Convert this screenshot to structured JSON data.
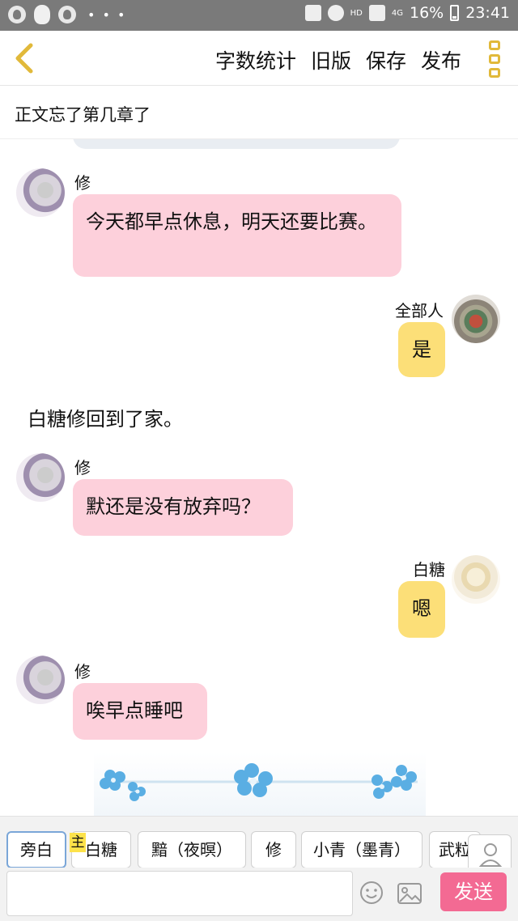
{
  "status_bar": {
    "more": "• • •",
    "hd": "HD",
    "signal": "4G",
    "battery": "16%",
    "time": "23:41"
  },
  "toolbar": {
    "back_icon": "chevron-left-icon",
    "actions": [
      "字数统计",
      "旧版",
      "保存",
      "发布"
    ],
    "menu_icon": "vertical-dots-icon",
    "accent_color": "#e1b93a"
  },
  "chapter": {
    "title": "正文忘了第几章了"
  },
  "messages": [
    {
      "side": "left",
      "sender": "修",
      "text": "今天都早点休息，明天还要比赛。",
      "bubble_color": "#fdd0db"
    },
    {
      "side": "right",
      "sender": "全部人",
      "text": "是",
      "bubble_color": "#fcdf78"
    },
    {
      "side": "narration",
      "text": "白糖修回到了家。"
    },
    {
      "side": "left",
      "sender": "修",
      "text": "默还是没有放弃吗？",
      "bubble_color": "#fdd0db"
    },
    {
      "side": "right",
      "sender": "白糖",
      "text": "嗯",
      "bubble_color": "#fcdf78"
    },
    {
      "side": "left",
      "sender": "修",
      "text": "唉早点睡吧",
      "bubble_color": "#fdd0db"
    }
  ],
  "character_bar": {
    "chips": [
      "旁白",
      "白糖",
      "黯（夜暝）",
      "修",
      "小青（墨青）",
      "武粒"
    ],
    "main_badge": "主",
    "active_chip": "旁白"
  },
  "input_bar": {
    "value": "",
    "send_label": "发送",
    "send_color": "#f36a93"
  }
}
